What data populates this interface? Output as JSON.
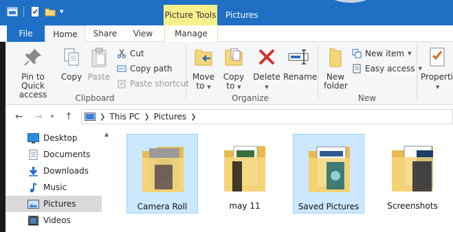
{
  "titlebar": {
    "context_tab": "Picture Tools",
    "window_title": "Pictures"
  },
  "tabs": {
    "file": "File",
    "home": "Home",
    "share": "Share",
    "view": "View",
    "manage": "Manage"
  },
  "clipboard": {
    "pin": "Pin to Quick access",
    "copy": "Copy",
    "paste": "Paste",
    "cut": "Cut",
    "copy_path": "Copy path",
    "paste_shortcut": "Paste shortcut",
    "group": "Clipboard"
  },
  "organize": {
    "move_to": "Move to",
    "copy_to": "Copy to",
    "delete": "Delete",
    "rename": "Rename",
    "group": "Organize"
  },
  "new": {
    "new_folder": "New folder",
    "new_item": "New item",
    "easy_access": "Easy access",
    "group": "New"
  },
  "open": {
    "properties": "Properties"
  },
  "address": {
    "crumbs": [
      "This PC",
      "Pictures"
    ]
  },
  "navpane": {
    "items": [
      "Desktop",
      "Documents",
      "Downloads",
      "Music",
      "Pictures",
      "Videos"
    ],
    "selected": "Pictures"
  },
  "folders": [
    {
      "name": "Camera Roll",
      "selected": true
    },
    {
      "name": "may 11",
      "selected": false
    },
    {
      "name": "Saved Pictures",
      "selected": true
    },
    {
      "name": "Screenshots",
      "selected": false
    }
  ],
  "colors": {
    "titlebar": "#1f6fc4",
    "context_tab": "#f6f08a",
    "selection": "#cce8ff",
    "folder": "#f6d67a",
    "delete_red": "#d0312d"
  }
}
